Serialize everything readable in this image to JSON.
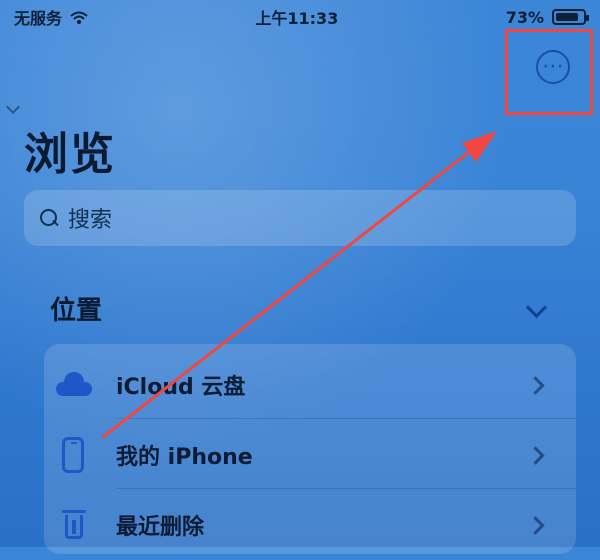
{
  "status_bar": {
    "carrier": "无服务",
    "time": "上午11:33",
    "battery": "73%",
    "wifi_icon": "wifi-icon",
    "battery_icon": "battery-icon"
  },
  "navigation": {
    "more_button_icon": "ellipsis-circle-icon",
    "more_button_glyph": "⋯"
  },
  "page": {
    "title": "浏览"
  },
  "search": {
    "placeholder": "搜索",
    "icon": "search-icon"
  },
  "locations": {
    "title": "位置",
    "collapse_icon": "chevron-down-icon",
    "items": [
      {
        "label": "iCloud 云盘",
        "icon": "cloud-icon"
      },
      {
        "label": "我的 iPhone",
        "icon": "phone-icon"
      },
      {
        "label": "最近删除",
        "icon": "trash-icon"
      }
    ]
  },
  "annotation": {
    "color": "#f24640"
  },
  "colors": {
    "accent": "#1f57c7",
    "background": "#3a84d6"
  }
}
